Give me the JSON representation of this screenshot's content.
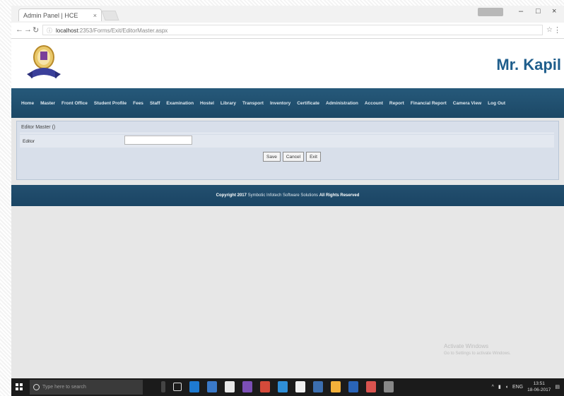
{
  "browser": {
    "tab_title": "Admin Panel | HCE",
    "tab_close": "×",
    "profile_label": "",
    "window_controls": [
      "–",
      "□",
      "×"
    ],
    "url_host": "localhost",
    "url_path": ":2353/Forms/Exit/EditorMaster.aspx",
    "nav_icons": [
      "arrow-left-icon",
      "arrow-right-icon",
      "reload-icon",
      "info-icon"
    ]
  },
  "header": {
    "user_name": "Mr. Kapil"
  },
  "nav": {
    "items": [
      "Home",
      "Master",
      "Front Office",
      "Student Profile",
      "Fees",
      "Staff",
      "Examination",
      "Hostel",
      "Library",
      "Transport",
      "Inventory",
      "Certificate",
      "Administration",
      "Account",
      "Report",
      "Financial Report",
      "Camera View",
      "Log Out"
    ]
  },
  "form": {
    "title": "Editor Master ()",
    "field_label": "Editor",
    "field_value": "",
    "buttons": {
      "save": "Save",
      "cancel": "Cancel",
      "exit": "Exit"
    }
  },
  "footer": {
    "copyright": "Copyright 2017",
    "company": "Symbotic Infotech Software Solutions",
    "rights": "All Rights Reserved"
  },
  "watermark": {
    "line1": "Activate Windows",
    "line2": "Go to Settings to activate Windows."
  },
  "taskbar": {
    "search_placeholder": "Type here to search",
    "time": "13:51",
    "date": "18-06-2017",
    "language": "ENG"
  },
  "colors": {
    "nav_bg": "#1f5070",
    "accent_text": "#1f5e8c",
    "panel_bg": "#d8dfea"
  }
}
